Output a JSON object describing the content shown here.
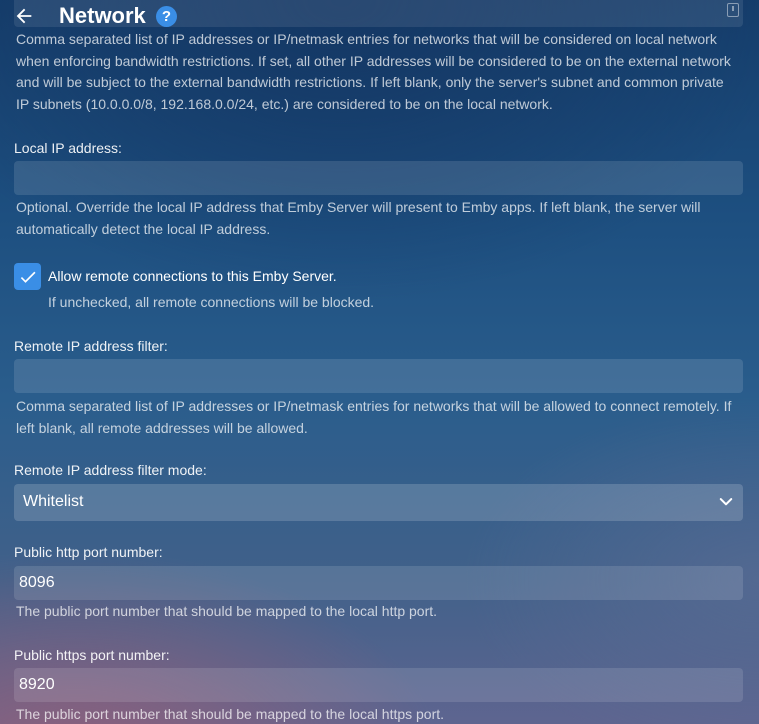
{
  "header": {
    "title": "Network",
    "help_glyph": "?"
  },
  "local_networks": {
    "description": "Comma separated list of IP addresses or IP/netmask entries for networks that will be considered on local network when enforcing bandwidth restrictions. If set, all other IP addresses will be considered to be on the external network and will be subject to the external bandwidth restrictions. If left blank, only the server's subnet and common private IP subnets (10.0.0.0/8, 192.168.0.0/24, etc.) are considered to be on the local network."
  },
  "local_ip": {
    "label": "Local IP address:",
    "value": "",
    "description": "Optional. Override the local IP address that Emby Server will present to Emby apps. If left blank, the server will automatically detect the local IP address."
  },
  "remote_access": {
    "checked": true,
    "label": "Allow remote connections to this Emby Server.",
    "description": "If unchecked, all remote connections will be blocked."
  },
  "remote_ip_filter": {
    "label": "Remote IP address filter:",
    "value": "",
    "description": "Comma separated list of IP addresses or IP/netmask entries for networks that will be allowed to connect remotely. If left blank, all remote addresses will be allowed."
  },
  "remote_ip_filter_mode": {
    "label": "Remote IP address filter mode:",
    "selected": "Whitelist"
  },
  "public_http_port": {
    "label": "Public http port number:",
    "value": "8096",
    "description": "The public port number that should be mapped to the local http port."
  },
  "public_https_port": {
    "label": "Public https port number:",
    "value": "8920",
    "description": "The public port number that should be mapped to the local https port."
  },
  "icons": {
    "back": "arrow-left-icon",
    "help": "help-icon",
    "field_action": "info-icon",
    "check": "check-icon",
    "dropdown": "chevron-down-icon"
  },
  "colors": {
    "accent": "#3a8ee6"
  }
}
